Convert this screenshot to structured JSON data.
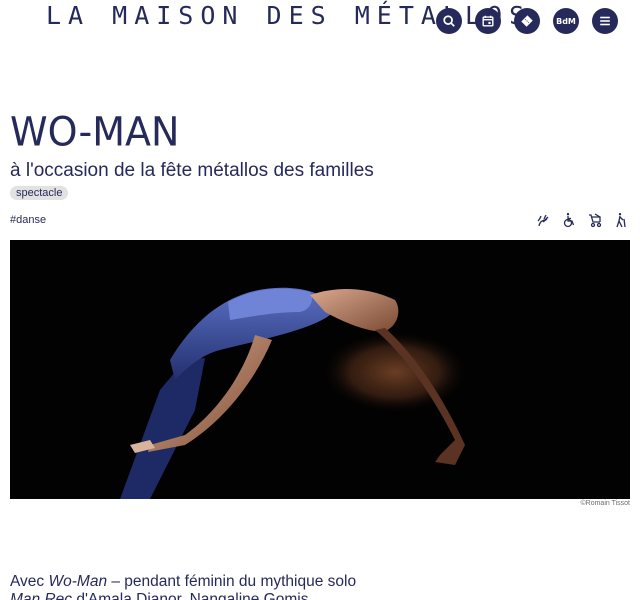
{
  "header": {
    "logo_text": "LA MAISON DES MÉTALLOS",
    "nav": [
      {
        "name": "search-icon",
        "label": ""
      },
      {
        "name": "calendar-icon",
        "label": ""
      },
      {
        "name": "ticket-icon",
        "label": ""
      },
      {
        "name": "bdm-icon",
        "label": "BdM"
      },
      {
        "name": "menu-icon",
        "label": ""
      }
    ]
  },
  "event": {
    "title": "WO-MAN",
    "subtitle": "à l'occasion de la fête métallos des familles",
    "category_badge": "spectacle",
    "hashtag": "#danse",
    "accessibility_icons": [
      "sign-language-icon",
      "wheelchair-icon",
      "stroller-icon",
      "cane-walker-icon"
    ]
  },
  "photo": {
    "credit": "©Romain Tissot"
  },
  "body": {
    "text_1": "Avec ",
    "work_title": "Wo-Man",
    "text_2": " – pendant féminin du mythique solo ",
    "solo_title": "Man Rec",
    "text_3": " d'Amala Dianor, Nangaline Gomis"
  },
  "colors": {
    "brand_navy": "#262a5a",
    "badge_grey": "#e2e2e2",
    "photo_bg": "#020202"
  }
}
